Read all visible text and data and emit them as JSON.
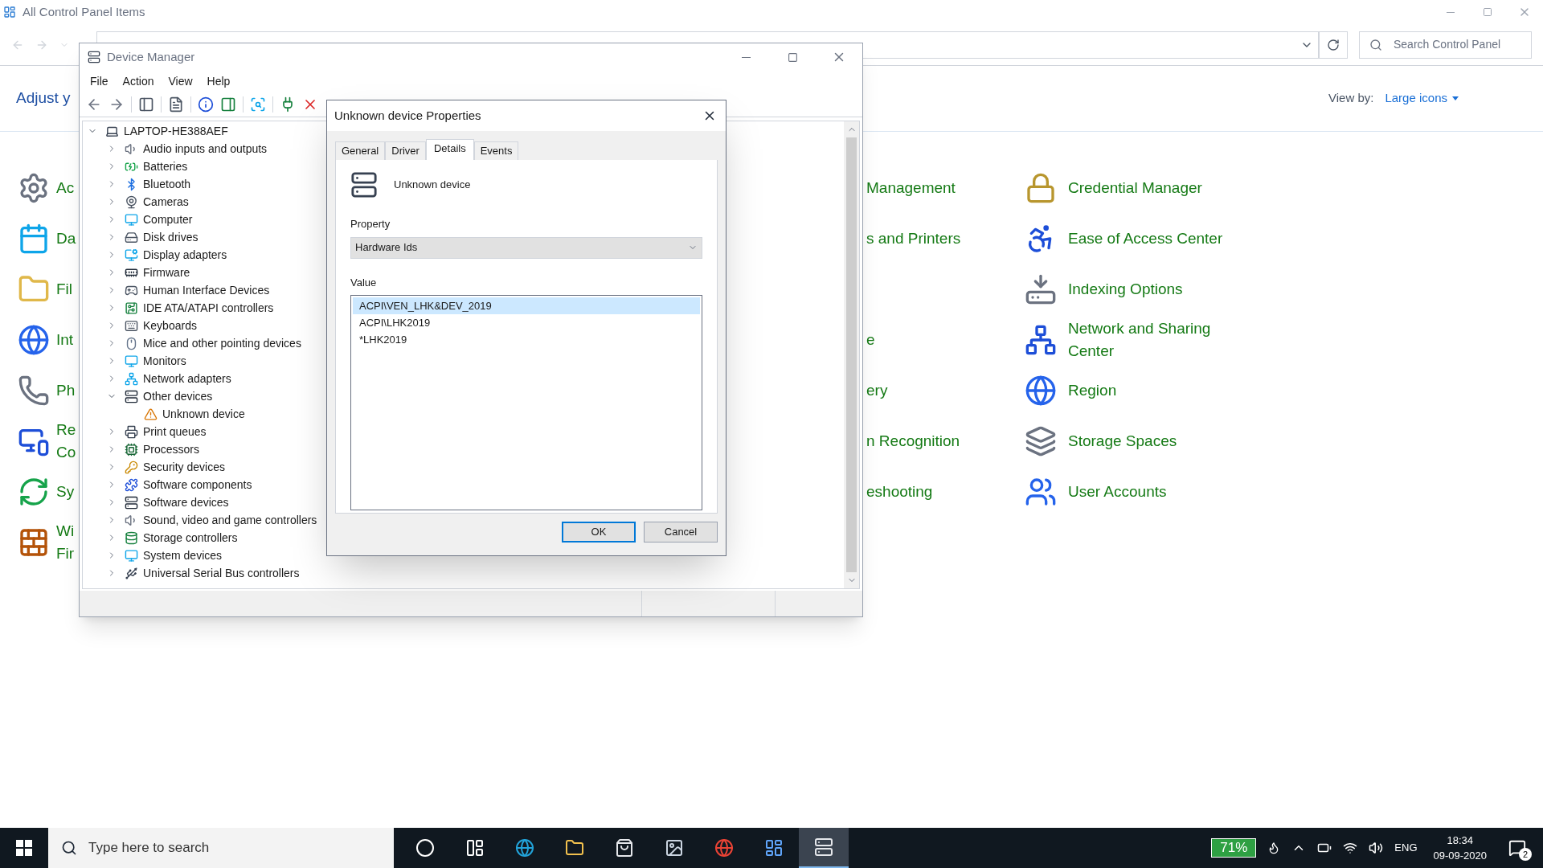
{
  "control_panel": {
    "title": "All Control Panel Items",
    "search_placeholder": "Search Control Panel",
    "heading": "Adjust y",
    "view_by_label": "View by:",
    "view_by_value": "Large icons",
    "rows": [
      {
        "left": [
          "Ac"
        ],
        "middle": [
          "Management"
        ],
        "right": [
          "Credential Manager"
        ]
      },
      {
        "left": [
          "Da"
        ],
        "middle": [
          "s and Printers"
        ],
        "right": [
          "Ease of Access Center"
        ]
      },
      {
        "left": [
          "Fil"
        ],
        "right": [
          "Indexing Options"
        ]
      },
      {
        "left": [
          "Int"
        ],
        "middle": [
          "e"
        ],
        "right": [
          "Network and Sharing",
          "Center"
        ]
      },
      {
        "left": [
          "Ph"
        ],
        "middle": [
          "ery"
        ],
        "right": [
          "Region"
        ]
      },
      {
        "left": [
          "Re",
          "Co"
        ],
        "middle": [
          "n Recognition"
        ],
        "right": [
          "Storage Spaces"
        ]
      },
      {
        "left": [
          "Sy"
        ],
        "middle": [
          "eshooting"
        ],
        "right": [
          "User Accounts"
        ]
      },
      {
        "left": [
          "Wi",
          "Fir"
        ]
      }
    ]
  },
  "device_manager": {
    "title": "Device Manager",
    "menu": [
      "File",
      "Action",
      "View",
      "Help"
    ],
    "tree": {
      "label": "LAPTOP-HE388AEF",
      "expanded": true,
      "children": [
        {
          "label": "Audio inputs and outputs",
          "expanded": false
        },
        {
          "label": "Batteries",
          "expanded": false
        },
        {
          "label": "Bluetooth",
          "expanded": false
        },
        {
          "label": "Cameras",
          "expanded": false
        },
        {
          "label": "Computer",
          "expanded": false
        },
        {
          "label": "Disk drives",
          "expanded": false
        },
        {
          "label": "Display adapters",
          "expanded": false
        },
        {
          "label": "Firmware",
          "expanded": false
        },
        {
          "label": "Human Interface Devices",
          "expanded": false
        },
        {
          "label": "IDE ATA/ATAPI controllers",
          "expanded": false
        },
        {
          "label": "Keyboards",
          "expanded": false
        },
        {
          "label": "Mice and other pointing devices",
          "expanded": false
        },
        {
          "label": "Monitors",
          "expanded": false
        },
        {
          "label": "Network adapters",
          "expanded": false
        },
        {
          "label": "Other devices",
          "expanded": true,
          "children": [
            {
              "label": "Unknown device"
            }
          ]
        },
        {
          "label": "Print queues",
          "expanded": false
        },
        {
          "label": "Processors",
          "expanded": false
        },
        {
          "label": "Security devices",
          "expanded": false
        },
        {
          "label": "Software components",
          "expanded": false
        },
        {
          "label": "Software devices",
          "expanded": false
        },
        {
          "label": "Sound, video and game controllers",
          "expanded": false
        },
        {
          "label": "Storage controllers",
          "expanded": false
        },
        {
          "label": "System devices",
          "expanded": false
        },
        {
          "label": "Universal Serial Bus controllers",
          "expanded": false
        }
      ]
    }
  },
  "properties_dialog": {
    "title": "Unknown device Properties",
    "tabs": [
      {
        "label": "General",
        "selected": false
      },
      {
        "label": "Driver",
        "selected": false
      },
      {
        "label": "Details",
        "selected": true
      },
      {
        "label": "Events",
        "selected": false
      }
    ],
    "device_name": "Unknown device",
    "property_label": "Property",
    "property_value": "Hardware Ids",
    "value_label": "Value",
    "values": [
      {
        "text": "ACPI\\VEN_LHK&DEV_2019",
        "selected": true
      },
      {
        "text": "ACPI\\LHK2019",
        "selected": false
      },
      {
        "text": "*LHK2019",
        "selected": false
      }
    ],
    "buttons": [
      {
        "label": "OK",
        "default": true
      },
      {
        "label": "Cancel",
        "default": false
      }
    ]
  },
  "taskbar": {
    "search_placeholder": "Type here to search",
    "apps": [
      {
        "active": false
      },
      {
        "active": false
      },
      {
        "active": false
      },
      {
        "active": false
      },
      {
        "active": false
      },
      {
        "active": false
      },
      {
        "active": false
      },
      {
        "active": false
      },
      {
        "active": true
      }
    ],
    "battery": "71%",
    "language": "ENG",
    "time": "18:34",
    "date": "09-09-2020",
    "notifications": "2"
  }
}
